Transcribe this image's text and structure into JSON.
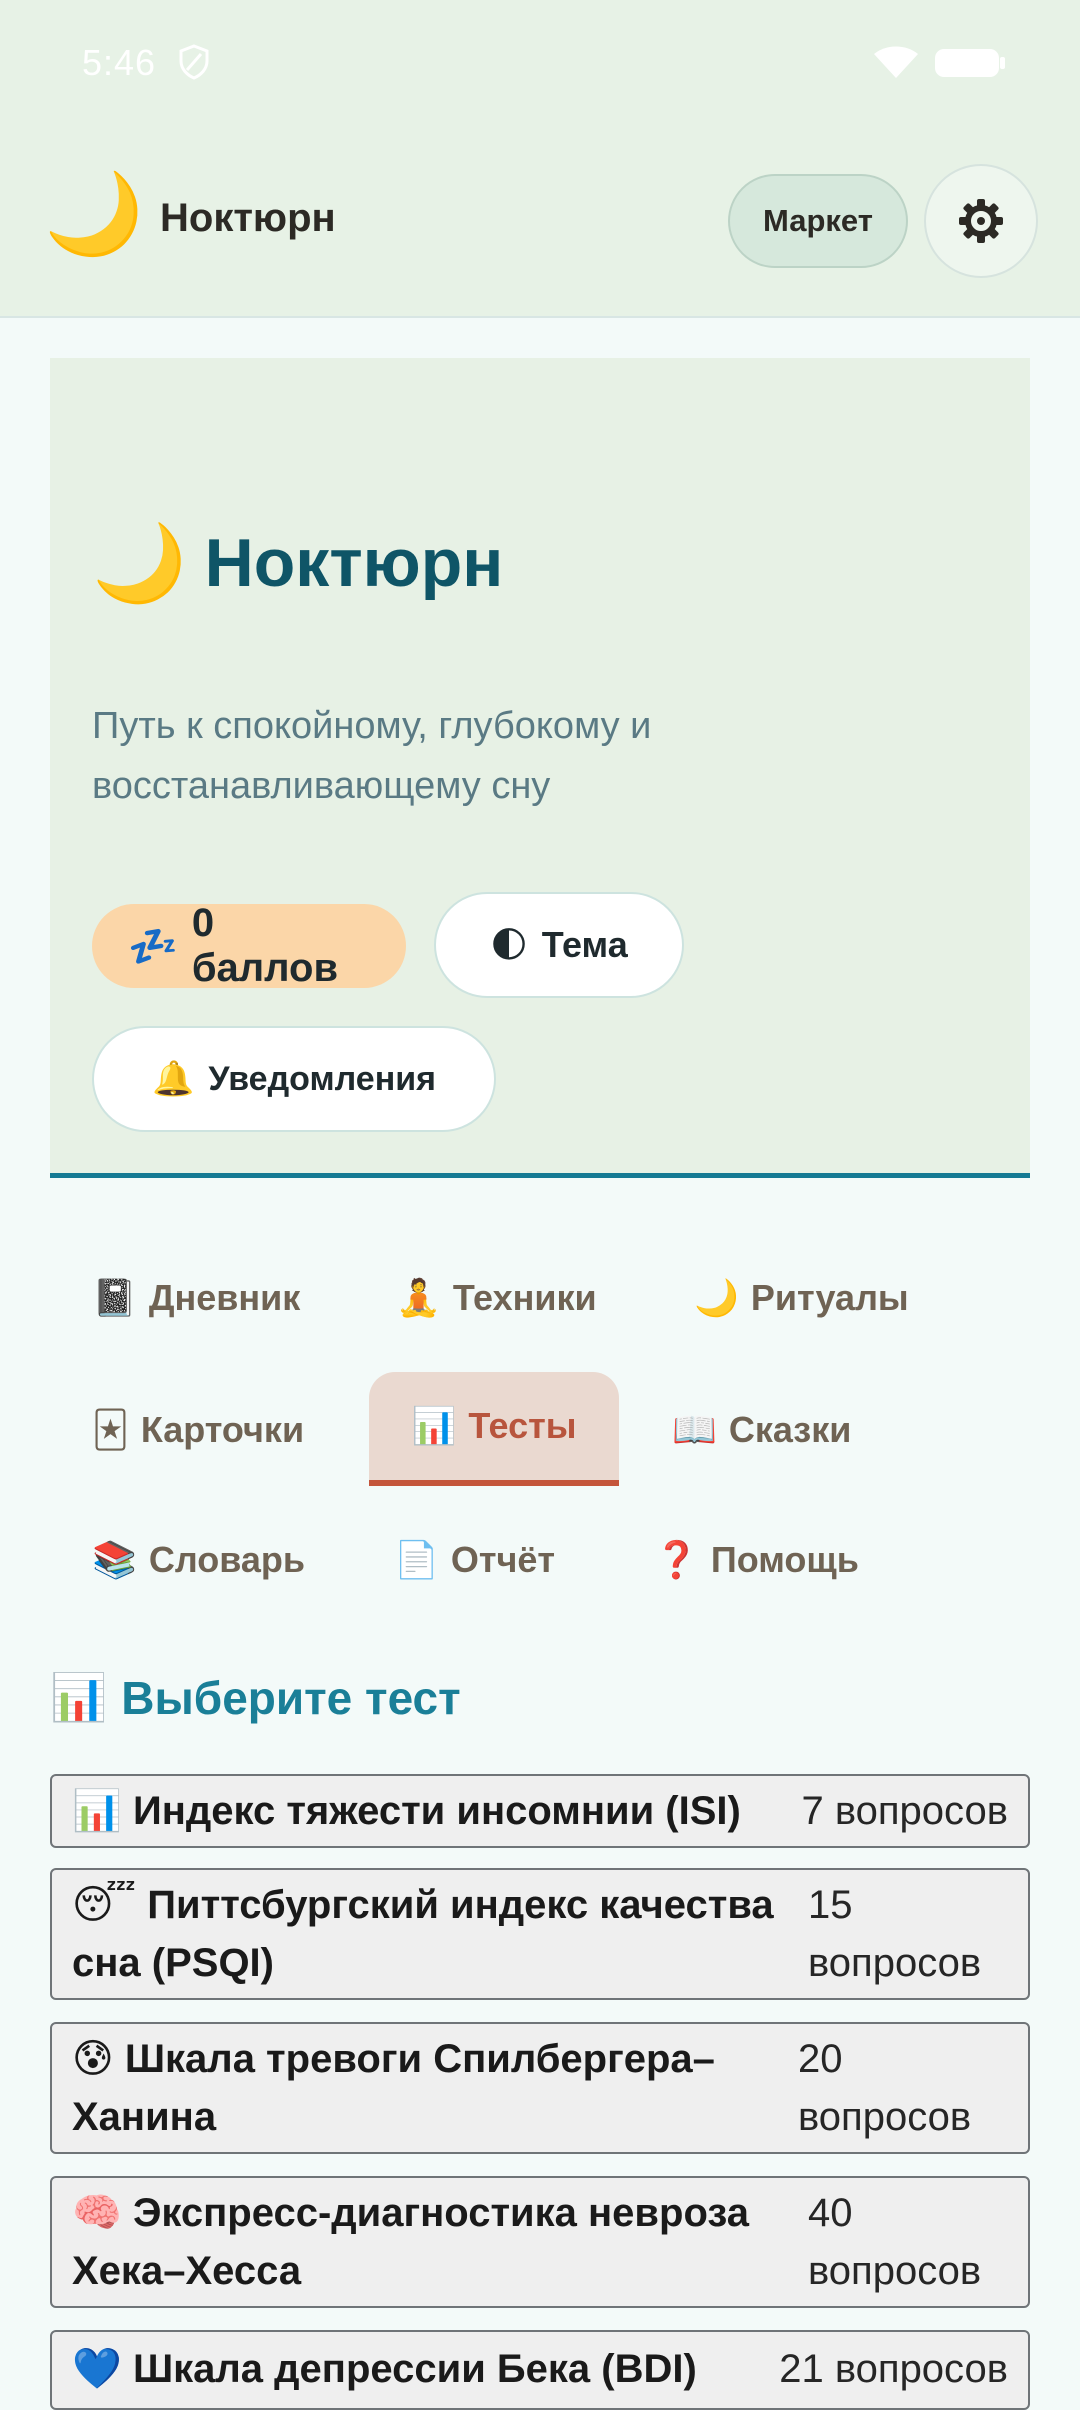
{
  "status_bar": {
    "time": "5:46"
  },
  "app": {
    "logo": "🌙",
    "title": "Ноктюрн",
    "market_label": "Маркет",
    "settings_icon": "gear-icon"
  },
  "hero": {
    "emoji": "🌙",
    "title": "Ноктюрн",
    "subtitle": "Путь к спокойному, глубокому и восстанавливающему сну",
    "score_emoji": "💤",
    "score_label": "0 баллов",
    "theme_emoji": "🌓",
    "theme_label": "Тема",
    "notif_emoji": "🔔",
    "notif_label": "Уведомления"
  },
  "tabs": [
    {
      "emoji": "📓",
      "label": "Дневник"
    },
    {
      "emoji": "🧘",
      "label": "Техники"
    },
    {
      "emoji": "🌙",
      "label": "Ритуалы"
    },
    {
      "emoji": "🃏",
      "label": "Карточки"
    },
    {
      "emoji": "📊",
      "label": "Тесты",
      "active": true
    },
    {
      "emoji": "📖",
      "label": "Сказки"
    },
    {
      "emoji": "📚",
      "label": "Словарь"
    },
    {
      "emoji": "📄",
      "label": "Отчёт"
    },
    {
      "emoji": "❓",
      "label": "Помощь"
    }
  ],
  "section": {
    "emoji": "📊",
    "title": "Выберите тест"
  },
  "tests": [
    {
      "emoji": "📊",
      "name": "Индекс тяжести инсомнии (ISI)",
      "count": "7 вопросов"
    },
    {
      "emoji": "😴",
      "name": "Питтсбургский индекс качества сна (PSQI)",
      "count": "15 вопросов"
    },
    {
      "emoji": "😰",
      "name": "Шкала тревоги Спилбергера–Ханина",
      "count": "20 вопросов"
    },
    {
      "emoji": "🧠",
      "name": "Экспресс-диагностика невроза Хека–Хесса",
      "count": "40 вопросов"
    },
    {
      "emoji": "💙",
      "name": "Шкала депрессии Бека (BDI)",
      "count": "21 вопросов"
    }
  ],
  "colors": {
    "accent": "#1a7f98",
    "active_tab": "#b8553d",
    "header_bg": "#e7f2e6"
  }
}
